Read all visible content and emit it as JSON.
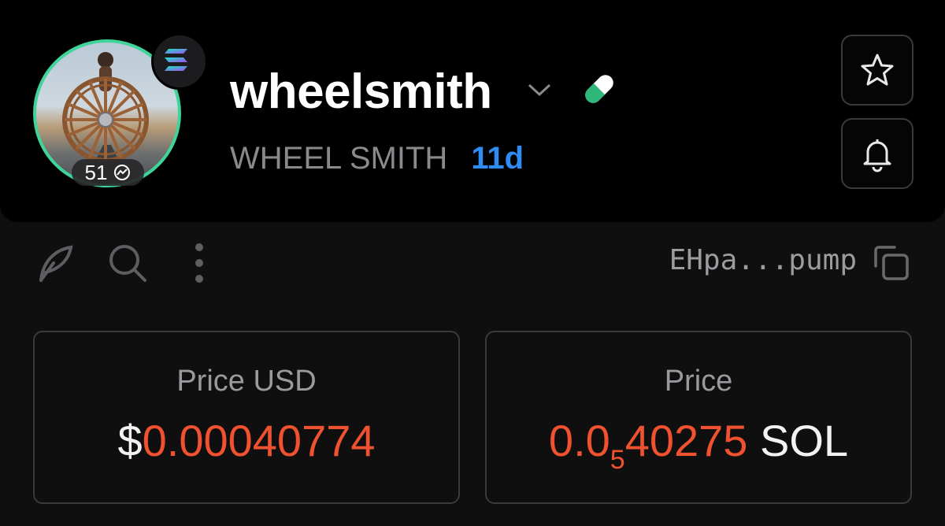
{
  "token": {
    "symbol": "wheelsmith",
    "name": "WHEEL SMITH",
    "age": "11d",
    "holders_count": "51",
    "chain_icon": "solana-logo-icon",
    "dex_icon": "pill-icon"
  },
  "actions": {
    "favorite_icon": "star-icon",
    "alert_icon": "bell-icon",
    "toolbar_icons": [
      "feather-icon",
      "search-icon",
      "more-vertical-icon"
    ],
    "address": "EHpa...pump",
    "copy_icon": "copy-icon"
  },
  "prices": {
    "usd": {
      "label": "Price USD",
      "prefix": "$",
      "value": "0.00040774"
    },
    "native": {
      "label": "Price",
      "lead": "0.0",
      "zeros_subscript": "5",
      "digits": "40275",
      "unit": "SOL"
    }
  },
  "colors": {
    "accent_green": "#3fd49a",
    "age_blue": "#2f8cf2",
    "price_orange": "#f0512f",
    "background": "#0f0f10"
  }
}
